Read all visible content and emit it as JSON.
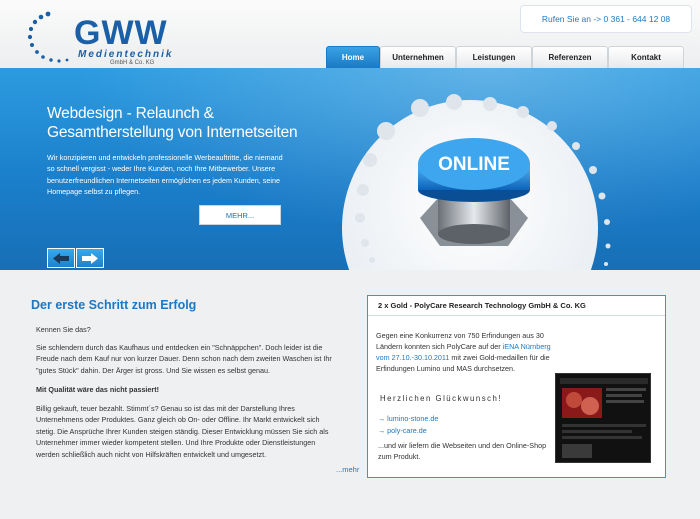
{
  "logo": {
    "title": "GWW",
    "subtitle": "Medientechnik",
    "company_form": "GmbH & Co. KG"
  },
  "phone": "Rufen Sie an -> 0 361 - 644 12 08",
  "nav": [
    "Home",
    "Unternehmen",
    "Leistungen",
    "Referenzen",
    "Kontakt"
  ],
  "hero": {
    "title_line1": "Webdesign - Relaunch &",
    "title_line2": "Gesamtherstellung von Internetseiten",
    "text": "Wir konzipieren und entwickeln professionelle Werbeauftritte, die niemand so schnell vergisst - weder Ihre Kunden, noch Ihre Mitbewerber. Unsere benutzerfreundlichen Internetseiten ermöglichen es jedem Kunden, seine Homepage selbst zu pflegen.",
    "more_label": "MEHR...",
    "button_label": "ONLINE"
  },
  "main": {
    "title": "Der erste Schritt zum Erfolg",
    "p1": "Kennen Sie das?",
    "p2": "Sie schlendern durch das Kaufhaus und entdecken ein \"Schnäppchen\". Doch leider ist die Freude nach dem Kauf nur von kurzer Dauer. Denn schon nach dem zweiten Waschen ist Ihr \"gutes Stück\" dahin. Der Ärger ist gross. Und Sie wissen es selbst genau.",
    "p3": "Mit Qualität wäre das nicht passiert!",
    "p4": "Billig gekauft, teuer bezahlt. Stimmt´s? Genau so ist das mit der Darstellung Ihres Unternehmens oder Produktes. Ganz gleich ob On- oder Offline. Ihr Markt entwickelt sich stetig. Die Ansprüche Ihrer Kunden steigen ständig. Dieser Entwicklung müssen Sie sich als Unternehmer immer wieder kompetent stellen. Und Ihre Produkte oder Dienstleistungen werden schließlich auch nicht von Hilfskräften entwickelt und umgesetzt.",
    "more": "...mehr"
  },
  "news": {
    "head": "2 x Gold - PolyCare Research Technology GmbH & Co. KG",
    "text_a": "Gegen eine Konkurrenz von 750 Erfindungen aus 30 Ländern konnten sich PolyCare auf der ",
    "text_link": "iENA Nürnberg vom 27.10.-30.10.2011",
    "text_b": " mit zwei Gold-medaillen für die Erfindungen Lumino und MAS durchsetzen.",
    "congrats": "Herzlichen Glückwunsch!",
    "link1": "→ lumino-stone.de",
    "link2": "→ poly-care.de",
    "foot": "...und wir liefern die Webseiten und den Online-Shop zum Produkt."
  },
  "colors": {
    "accent": "#1b78c6",
    "hero": "#2c9be0",
    "link": "#1e78c0"
  }
}
